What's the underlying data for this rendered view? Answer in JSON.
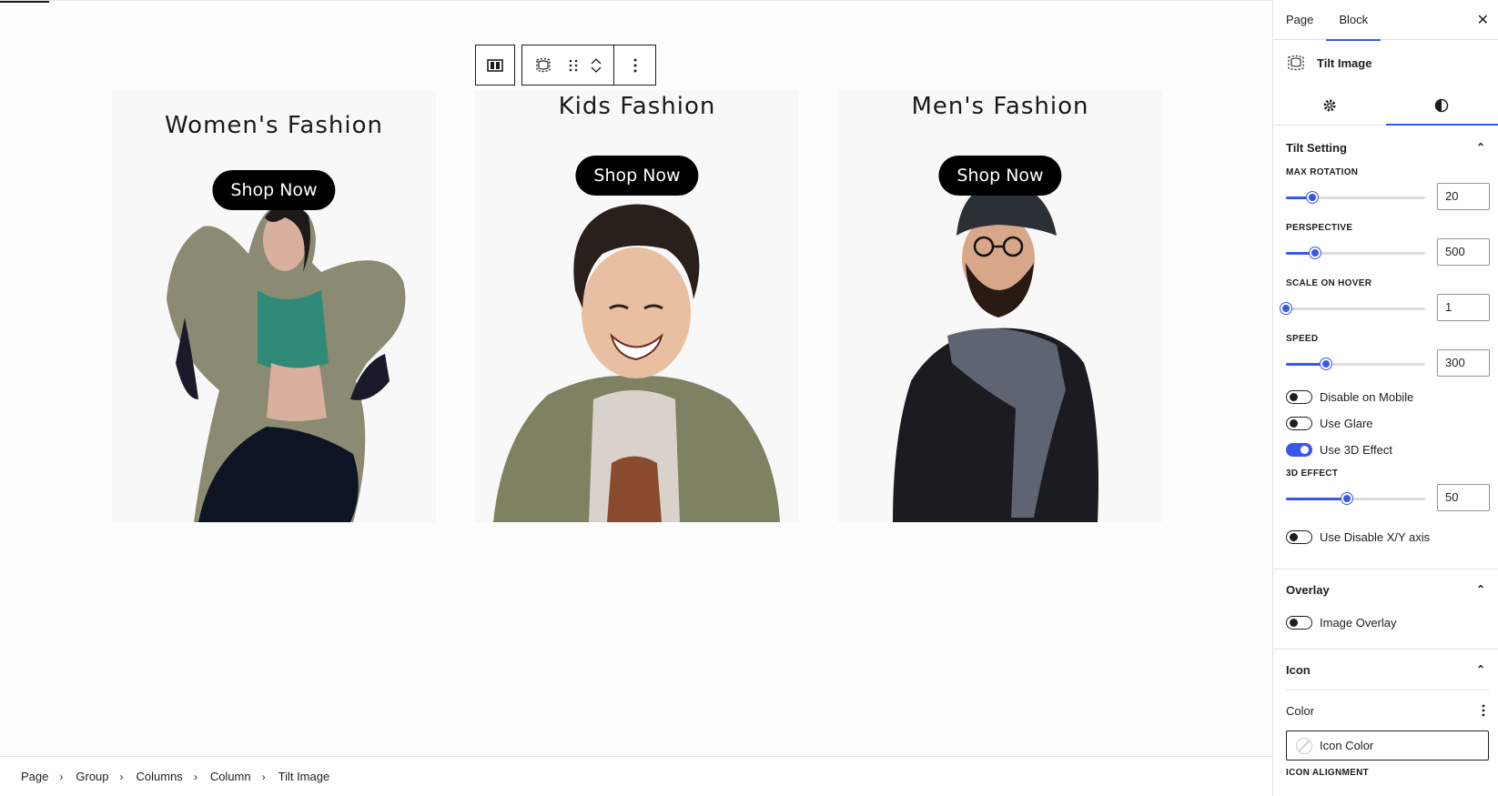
{
  "cards": [
    {
      "title": "Women's Fashion",
      "button": "Shop Now"
    },
    {
      "title": "Kids Fashion",
      "button": "Shop Now"
    },
    {
      "title": "Men's Fashion",
      "button": "Shop Now"
    }
  ],
  "breadcrumb": [
    "Page",
    "Group",
    "Columns",
    "Column",
    "Tilt Image"
  ],
  "sidebar": {
    "tabs": {
      "page": "Page",
      "block": "Block"
    },
    "block_name": "Tilt Image",
    "tilt_panel": {
      "title": "Tilt Setting",
      "max_rotation": {
        "label": "MAX ROTATION",
        "value": "20",
        "fraction": 0.19
      },
      "perspective": {
        "label": "PERSPECTIVE",
        "value": "500",
        "fraction": 0.21
      },
      "scale_on_hover": {
        "label": "SCALE ON HOVER",
        "value": "1",
        "fraction": 0.0
      },
      "speed": {
        "label": "SPEED",
        "value": "300",
        "fraction": 0.29
      },
      "disable_mobile": {
        "label": "Disable on Mobile",
        "on": false
      },
      "use_glare": {
        "label": "Use Glare",
        "on": false
      },
      "use_3d": {
        "label": "Use 3D Effect",
        "on": true
      },
      "effect_3d": {
        "label": "3D EFFECT",
        "value": "50",
        "fraction": 0.44
      },
      "disable_xy": {
        "label": "Use Disable X/Y axis",
        "on": false
      }
    },
    "overlay_panel": {
      "title": "Overlay",
      "image_overlay": "Image Overlay"
    },
    "icon_panel": {
      "title": "Icon",
      "color_label": "Color",
      "icon_color": "Icon Color",
      "alignment_label": "ICON ALIGNMENT"
    }
  },
  "colors": {
    "accent": "#3858e9",
    "button_bg": "#000000",
    "card_bg": "#f8f8f9"
  }
}
